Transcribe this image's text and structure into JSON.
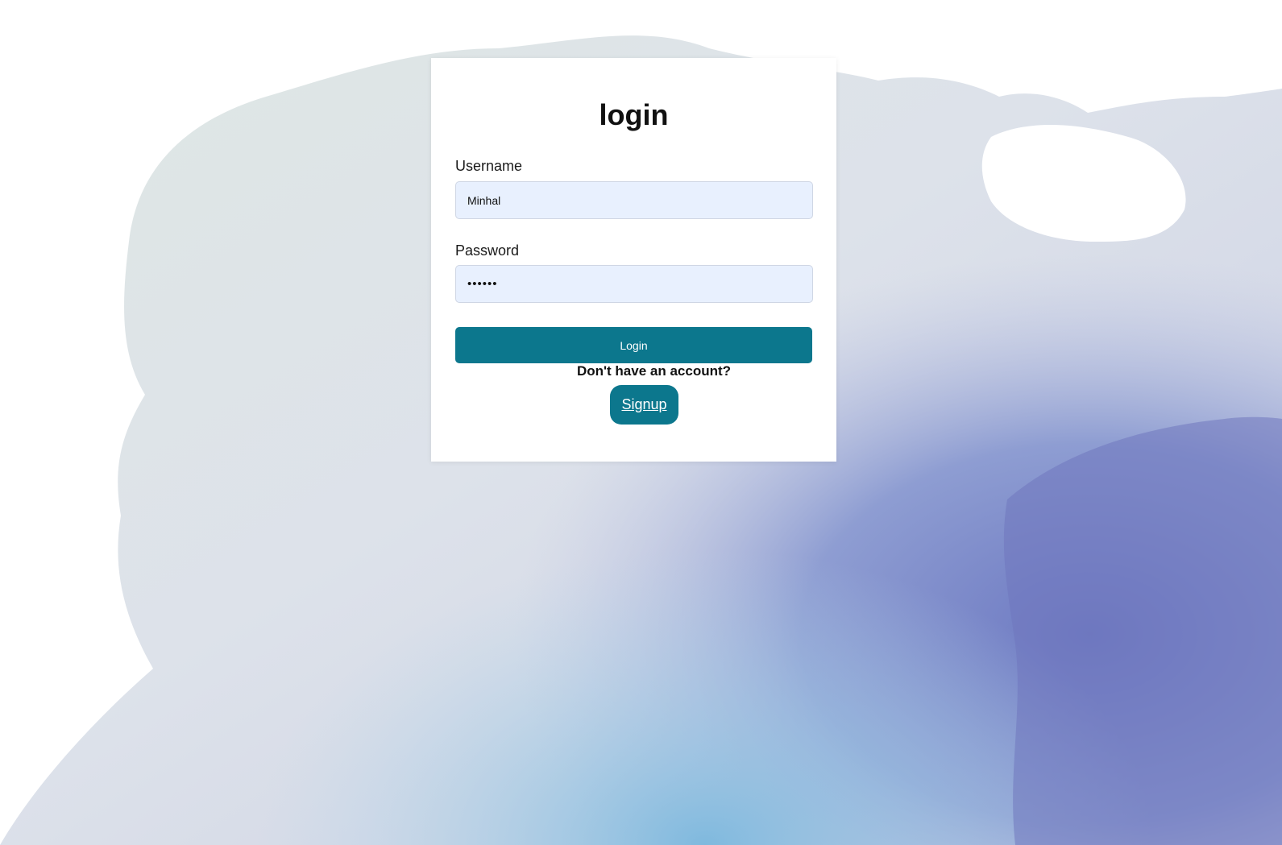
{
  "page": {
    "background_style": "pastel map background"
  },
  "login_form": {
    "title": "login",
    "username_label": "Username",
    "username_value": "Minhal",
    "password_label": "Password",
    "password_value": "••••••",
    "login_button_label": "Login",
    "no_account_text": "Don't have an account?",
    "signup_label": "Signup"
  },
  "colors": {
    "accent": "#0c778d",
    "input_background": "#e8f0fe",
    "card_background": "#ffffff"
  }
}
